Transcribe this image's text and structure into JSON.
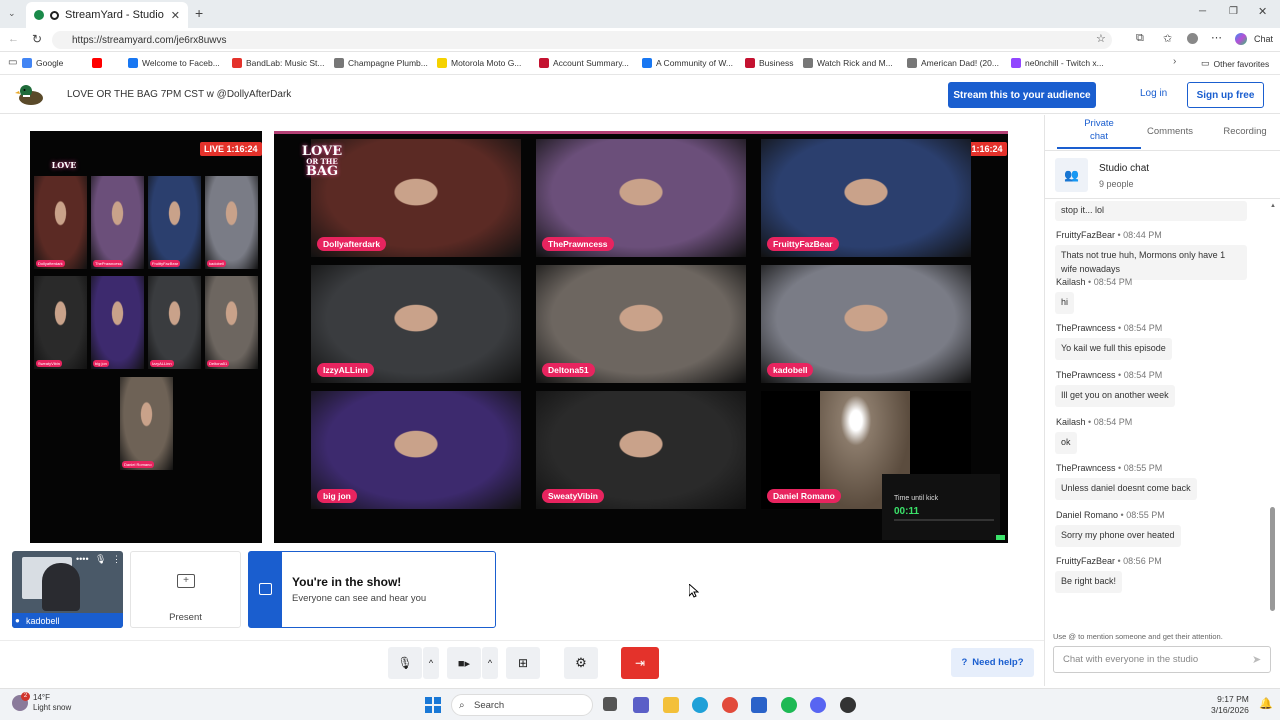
{
  "browser": {
    "tab_title": "StreamYard - Studio",
    "url": "https://streamyard.com/je6rx8uwvs",
    "chat_button": "Chat",
    "bookmarks": [
      {
        "label": "Google",
        "color": "#4285f4"
      },
      {
        "label": "",
        "color": "#ff0000"
      },
      {
        "label": "Welcome to Faceb...",
        "color": "#1877f2"
      },
      {
        "label": "BandLab: Music St...",
        "color": "#e4322b"
      },
      {
        "label": "Champagne Plumb...",
        "color": "#777777"
      },
      {
        "label": "Motorola Moto G...",
        "color": "#f5d200"
      },
      {
        "label": "Account Summary...",
        "color": "#c41230"
      },
      {
        "label": "A Community of W...",
        "color": "#1877f2"
      },
      {
        "label": "Business",
        "color": "#c41230"
      },
      {
        "label": "Watch Rick and M...",
        "color": "#777777"
      },
      {
        "label": "American Dad! (20...",
        "color": "#777777"
      },
      {
        "label": "ne0nchill - Twitch x...",
        "color": "#9146ff"
      }
    ],
    "other_favorites": "Other favorites"
  },
  "header": {
    "studio_title": "LOVE OR THE BAG 7PM CST w @DollyAfterDark",
    "stream_button": "Stream this to your audience",
    "login": "Log in",
    "signup": "Sign up free"
  },
  "stage": {
    "live_badge": "LIVE 1:16:24",
    "logo_line1": "LOVE",
    "logo_line2": "OR THE",
    "logo_line3": "BAG",
    "tiles": [
      {
        "name": "Dollyafterdark",
        "bg": "#5b2a24"
      },
      {
        "name": "ThePrawncess",
        "bg": "#6b4f7a"
      },
      {
        "name": "FruittyFazBear",
        "bg": "#2b3f6e"
      },
      {
        "name": "IzzyALLinn",
        "bg": "#3a3c3f"
      },
      {
        "name": "Deltona51",
        "bg": "#6d6660"
      },
      {
        "name": "kadobell",
        "bg": "#7a7c86"
      },
      {
        "name": "big jon",
        "bg": "#3d2a6e"
      },
      {
        "name": "SweatyVibin",
        "bg": "#2a2a2a"
      },
      {
        "name": "Daniel Romano",
        "bg": "#6e6256"
      }
    ],
    "mini_tiles": [
      {
        "name": "Dollyafterdark",
        "bg": "#5b2a24"
      },
      {
        "name": "ThePrawncess",
        "bg": "#6b4f7a"
      },
      {
        "name": "FruittyFazBear",
        "bg": "#2b3f6e"
      },
      {
        "name": "kadobell",
        "bg": "#7a7c86"
      },
      {
        "name": "SweatyVibin",
        "bg": "#2a2a2a"
      },
      {
        "name": "big jon",
        "bg": "#3d2a6e"
      },
      {
        "name": "IzzyALLinn",
        "bg": "#3a3c3f"
      },
      {
        "name": "Deltona51",
        "bg": "#6d6660"
      },
      {
        "name": "Daniel Romano",
        "bg": "#6e6256"
      }
    ],
    "kick_label": "Time until kick",
    "kick_time": "00:11"
  },
  "bottom": {
    "self_name": "kadobell",
    "present": "Present",
    "show_title": "You're in the show!",
    "show_sub": "Everyone can see and hear you",
    "need_help": "Need help?"
  },
  "chat": {
    "tabs": [
      "Private chat",
      "Comments",
      "Recording"
    ],
    "title": "Studio chat",
    "people": "9 people",
    "partial": "stop it... lol",
    "messages": [
      {
        "author": "FruittyFazBear",
        "time": "08:44 PM",
        "text": "Thats not true huh, Mormons only have 1 wife nowadays"
      },
      {
        "author": "Kailash",
        "time": "08:54 PM",
        "text": "hi"
      },
      {
        "author": "ThePrawncess",
        "time": "08:54 PM",
        "text": "Yo kail we full this episode"
      },
      {
        "author": "ThePrawncess",
        "time": "08:54 PM",
        "text": "Ill get you on another week"
      },
      {
        "author": "Kailash",
        "time": "08:54 PM",
        "text": "ok"
      },
      {
        "author": "ThePrawncess",
        "time": "08:55 PM",
        "text": "Unless daniel doesnt come back"
      },
      {
        "author": "Daniel Romano",
        "time": "08:55 PM",
        "text": "Sorry my phone over heated"
      },
      {
        "author": "FruittyFazBear",
        "time": "08:56 PM",
        "text": "Be right back!"
      }
    ],
    "hint": "Use @ to mention someone and get their attention.",
    "input_placeholder": "Chat with everyone in the studio"
  },
  "taskbar": {
    "temp": "14°F",
    "weather": "Light snow",
    "badge": "2",
    "search": "Search",
    "time": "9:17 PM",
    "date": "3/16/2026"
  }
}
